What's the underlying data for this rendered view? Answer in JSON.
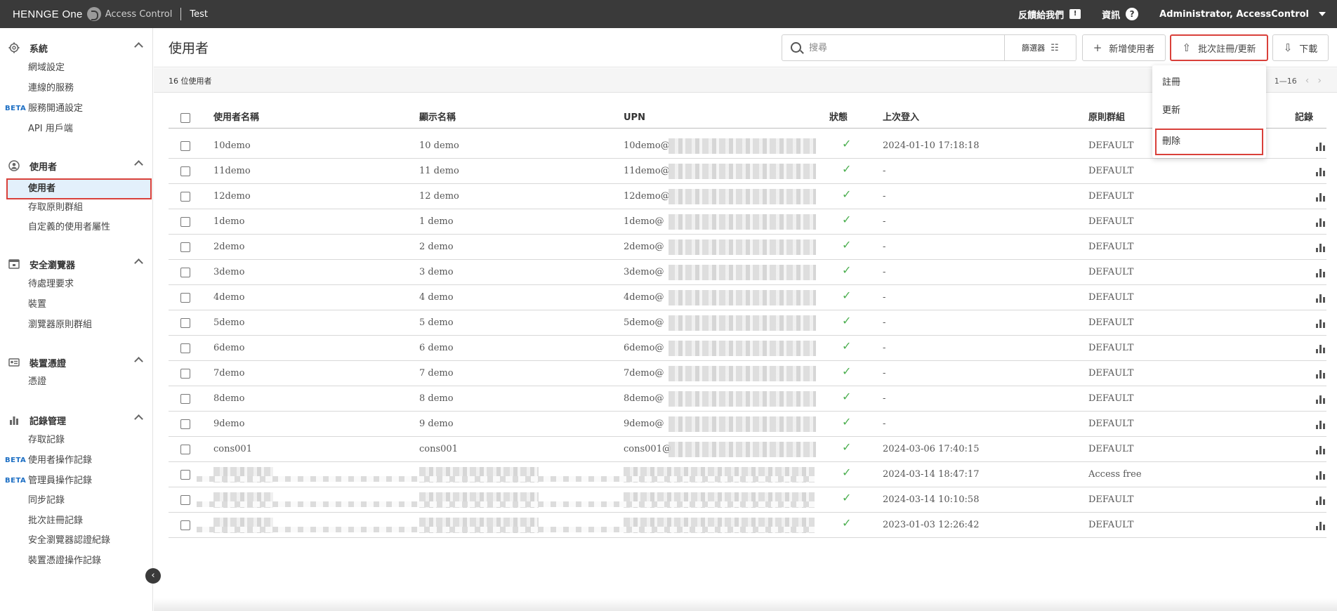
{
  "topbar": {
    "brand": "HENNGE One",
    "product": "Access Control",
    "tenant": "Test",
    "feedback": "反饋給我們",
    "feedback_icon": "!",
    "info": "資訊",
    "info_icon": "?",
    "user": "Administrator, AccessControl"
  },
  "sidebar": {
    "system": {
      "title": "系統",
      "items": [
        "網域設定",
        "連線的服務",
        "服務開通設定",
        "API 用戶端"
      ]
    },
    "users": {
      "title": "使用者",
      "items": [
        "使用者",
        "存取原則群組",
        "自定義的使用者屬性"
      ]
    },
    "browser": {
      "title": "安全瀏覽器",
      "items": [
        "待處理要求",
        "裝置",
        "瀏覽器原則群組"
      ]
    },
    "certs": {
      "title": "裝置憑證",
      "items": [
        "憑證"
      ]
    },
    "logs": {
      "title": "記錄管理",
      "items": [
        "存取記錄",
        "使用者操作記錄",
        "管理員操作記錄",
        "同步記錄",
        "批次註冊記錄",
        "安全瀏覽器認證紀錄",
        "裝置憑證操作記錄"
      ]
    },
    "beta_label": "BETA",
    "collapse_icon": "‹"
  },
  "header": {
    "title": "使用者",
    "search_placeholder": "搜尋",
    "filter": "篩選器",
    "add_user": "新增使用者",
    "bulk": "批次註冊/更新",
    "download": "下載"
  },
  "countbar": {
    "count": "16 位使用者",
    "range": "1—16"
  },
  "dropdown": {
    "items": [
      "註冊",
      "更新",
      "刪除"
    ]
  },
  "table": {
    "columns": [
      "使用者名稱",
      "顯示名稱",
      "UPN",
      "狀態",
      "上次登入",
      "原則群組",
      "記錄"
    ],
    "rows": [
      {
        "name": "10demo",
        "display": "10 demo",
        "upn": "10demo@",
        "last": "2024-01-10 17:18:18",
        "group": "DEFAULT"
      },
      {
        "name": "11demo",
        "display": "11 demo",
        "upn": "11demo@",
        "last": "-",
        "group": "DEFAULT"
      },
      {
        "name": "12demo",
        "display": "12 demo",
        "upn": "12demo@",
        "last": "-",
        "group": "DEFAULT"
      },
      {
        "name": "1demo",
        "display": "1 demo",
        "upn": "1demo@",
        "last": "-",
        "group": "DEFAULT"
      },
      {
        "name": "2demo",
        "display": "2 demo",
        "upn": "2demo@",
        "last": "-",
        "group": "DEFAULT"
      },
      {
        "name": "3demo",
        "display": "3 demo",
        "upn": "3demo@",
        "last": "-",
        "group": "DEFAULT"
      },
      {
        "name": "4demo",
        "display": "4 demo",
        "upn": "4demo@",
        "last": "-",
        "group": "DEFAULT"
      },
      {
        "name": "5demo",
        "display": "5 demo",
        "upn": "5demo@",
        "last": "-",
        "group": "DEFAULT"
      },
      {
        "name": "6demo",
        "display": "6 demo",
        "upn": "6demo@",
        "last": "-",
        "group": "DEFAULT"
      },
      {
        "name": "7demo",
        "display": "7 demo",
        "upn": "7demo@",
        "last": "-",
        "group": "DEFAULT"
      },
      {
        "name": "8demo",
        "display": "8 demo",
        "upn": "8demo@",
        "last": "-",
        "group": "DEFAULT"
      },
      {
        "name": "9demo",
        "display": "9 demo",
        "upn": "9demo@",
        "last": "-",
        "group": "DEFAULT"
      },
      {
        "name": "cons001",
        "display": "cons001",
        "upn": "cons001@",
        "last": "2024-03-06 17:40:15",
        "group": "DEFAULT"
      },
      {
        "name": "",
        "display": "",
        "upn": "",
        "last": "2024-03-14 18:47:17",
        "group": "Access free"
      },
      {
        "name": "",
        "display": "",
        "upn": "",
        "last": "2024-03-14 10:10:58",
        "group": "DEFAULT"
      },
      {
        "name": "",
        "display": "",
        "upn": "",
        "last": "2023-01-03 12:26:42",
        "group": "DEFAULT"
      }
    ]
  },
  "icons": {
    "check": "✓",
    "plus": "+",
    "upload": "⇧",
    "download": "⇩",
    "filter": "☷"
  },
  "colors": {
    "accent_red": "#d9403a",
    "active_bg": "#e3f0fb",
    "beta_blue": "#1d6fc4",
    "topbar": "#3a3a3a",
    "check_green": "#4caf50"
  }
}
